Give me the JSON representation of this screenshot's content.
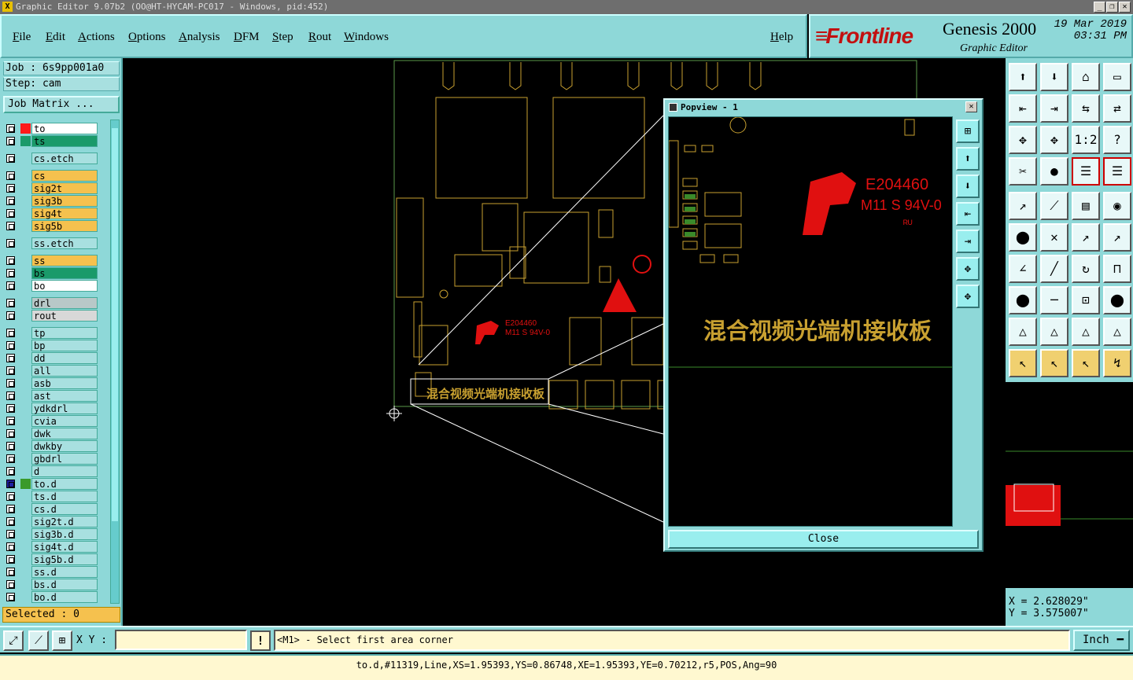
{
  "window": {
    "title": "Graphic Editor 9.07b2 (OO@HT-HYCAM-PC017 - Windows, pid:452)",
    "buttons": [
      "_",
      "❐",
      "✕"
    ]
  },
  "menu": [
    "File",
    "Edit",
    "Actions",
    "Options",
    "Analysis",
    "DFM",
    "Step",
    "Rout",
    "Windows"
  ],
  "help": "Help",
  "logo": {
    "brand": "Frontline",
    "product": "Genesis 2000",
    "subtitle": "Graphic Editor",
    "date": "19 Mar 2019",
    "time": "03:31 PM"
  },
  "job": {
    "job": "Job : 6s9pp001a0",
    "step": "Step: cam",
    "matrix_button": "Job Matrix ..."
  },
  "layers": [
    {
      "name": "to",
      "color": "#ff1a1a",
      "bg": "#ffffff",
      "mark": "✎"
    },
    {
      "name": "ts",
      "color": "#1a9a6a",
      "bg": "#1a9a6a"
    },
    {
      "name": "cs.etch",
      "color": "",
      "bg": "#a8e0e0"
    },
    {
      "name": "cs",
      "color": "",
      "bg": "#f5c14e"
    },
    {
      "name": "sig2t",
      "color": "",
      "bg": "#f5c14e"
    },
    {
      "name": "sig3b",
      "color": "",
      "bg": "#f5c14e"
    },
    {
      "name": "sig4t",
      "color": "",
      "bg": "#f5c14e"
    },
    {
      "name": "sig5b",
      "color": "",
      "bg": "#f5c14e"
    },
    {
      "name": "ss.etch",
      "color": "",
      "bg": "#a8e0e0"
    },
    {
      "name": "ss",
      "color": "",
      "bg": "#f5c14e"
    },
    {
      "name": "bs",
      "color": "",
      "bg": "#1a9a6a"
    },
    {
      "name": "bo",
      "color": "",
      "bg": "#ffffff"
    },
    {
      "name": "drl",
      "color": "",
      "bg": "#b8c8c8"
    },
    {
      "name": "rout",
      "color": "",
      "bg": "#d8d8d8"
    },
    {
      "name": "tp",
      "color": "",
      "bg": "#a8e0e0"
    },
    {
      "name": "bp",
      "color": "",
      "bg": "#a8e0e0"
    },
    {
      "name": "dd",
      "color": "",
      "bg": "#a8e0e0"
    },
    {
      "name": "all",
      "color": "",
      "bg": "#a8e0e0",
      "mark": "✎"
    },
    {
      "name": "asb",
      "color": "",
      "bg": "#a8e0e0"
    },
    {
      "name": "ast",
      "color": "",
      "bg": "#a8e0e0",
      "mark": "✎"
    },
    {
      "name": "ydkdrl",
      "color": "",
      "bg": "#a8e0e0"
    },
    {
      "name": "cvia",
      "color": "",
      "bg": "#a8e0e0"
    },
    {
      "name": "dwk",
      "color": "",
      "bg": "#a8e0e0"
    },
    {
      "name": "dwkby",
      "color": "",
      "bg": "#a8e0e0"
    },
    {
      "name": "gbdrl",
      "color": "",
      "bg": "#a8e0e0"
    },
    {
      "name": "d",
      "color": "",
      "bg": "#a8e0e0"
    },
    {
      "name": "to.d",
      "color": "#3a9a2a",
      "bg": "#a8e0e0",
      "mark": "✎ ⊞",
      "active": true
    },
    {
      "name": "ts.d",
      "color": "",
      "bg": "#a8e0e0"
    },
    {
      "name": "cs.d",
      "color": "",
      "bg": "#a8e0e0"
    },
    {
      "name": "sig2t.d",
      "color": "",
      "bg": "#a8e0e0"
    },
    {
      "name": "sig3b.d",
      "color": "",
      "bg": "#a8e0e0"
    },
    {
      "name": "sig4t.d",
      "color": "",
      "bg": "#a8e0e0"
    },
    {
      "name": "sig5b.d",
      "color": "",
      "bg": "#a8e0e0"
    },
    {
      "name": "ss.d",
      "color": "",
      "bg": "#a8e0e0"
    },
    {
      "name": "bs.d",
      "color": "",
      "bg": "#a8e0e0"
    },
    {
      "name": "bo.d",
      "color": "",
      "bg": "#a8e0e0"
    }
  ],
  "selected": "Selected : 0",
  "popview": {
    "title": "Popview - 1",
    "close": "Close"
  },
  "board": {
    "ul_text": "E204460",
    "ul_text2": "M11 S 94V-0",
    "ul_text_small": "E204460",
    "ul_text2_small": "M11 S 94V-0",
    "cn_label": "混合视频光端机接收板"
  },
  "coords": {
    "x": "X = 2.628029\"",
    "y": "Y = 3.575007\""
  },
  "status": {
    "xy_label": "X Y :",
    "xy_value": "",
    "bang": "!",
    "prompt": "<M1> - Select first area corner",
    "unit": "Inch"
  },
  "info_line": "to.d,#11319,Line,XS=1.95393,YS=0.86748,XE=1.95393,YE=0.70212,r5,POS,Ang=90",
  "tools": [
    "⬆",
    "⬇",
    "⌂",
    "▭",
    "⇤",
    "⇥",
    "⇆",
    "⇄",
    "✥",
    "✥",
    "1:2",
    "?",
    "✂",
    "●",
    "☰",
    "☰",
    "↗",
    "⟋",
    "▤",
    "◉",
    "⬤",
    "✕",
    "↗",
    "↗",
    "∠",
    "╱",
    "↻",
    "⊓",
    "⬤",
    "─",
    "⊡",
    "⬤",
    "△",
    "△",
    "△",
    "△",
    "↖",
    "↖",
    "↖",
    "↯"
  ],
  "popview_tools": [
    "⊞",
    "⬆",
    "⬇",
    "⇤",
    "⇥",
    "✥",
    "✥"
  ]
}
